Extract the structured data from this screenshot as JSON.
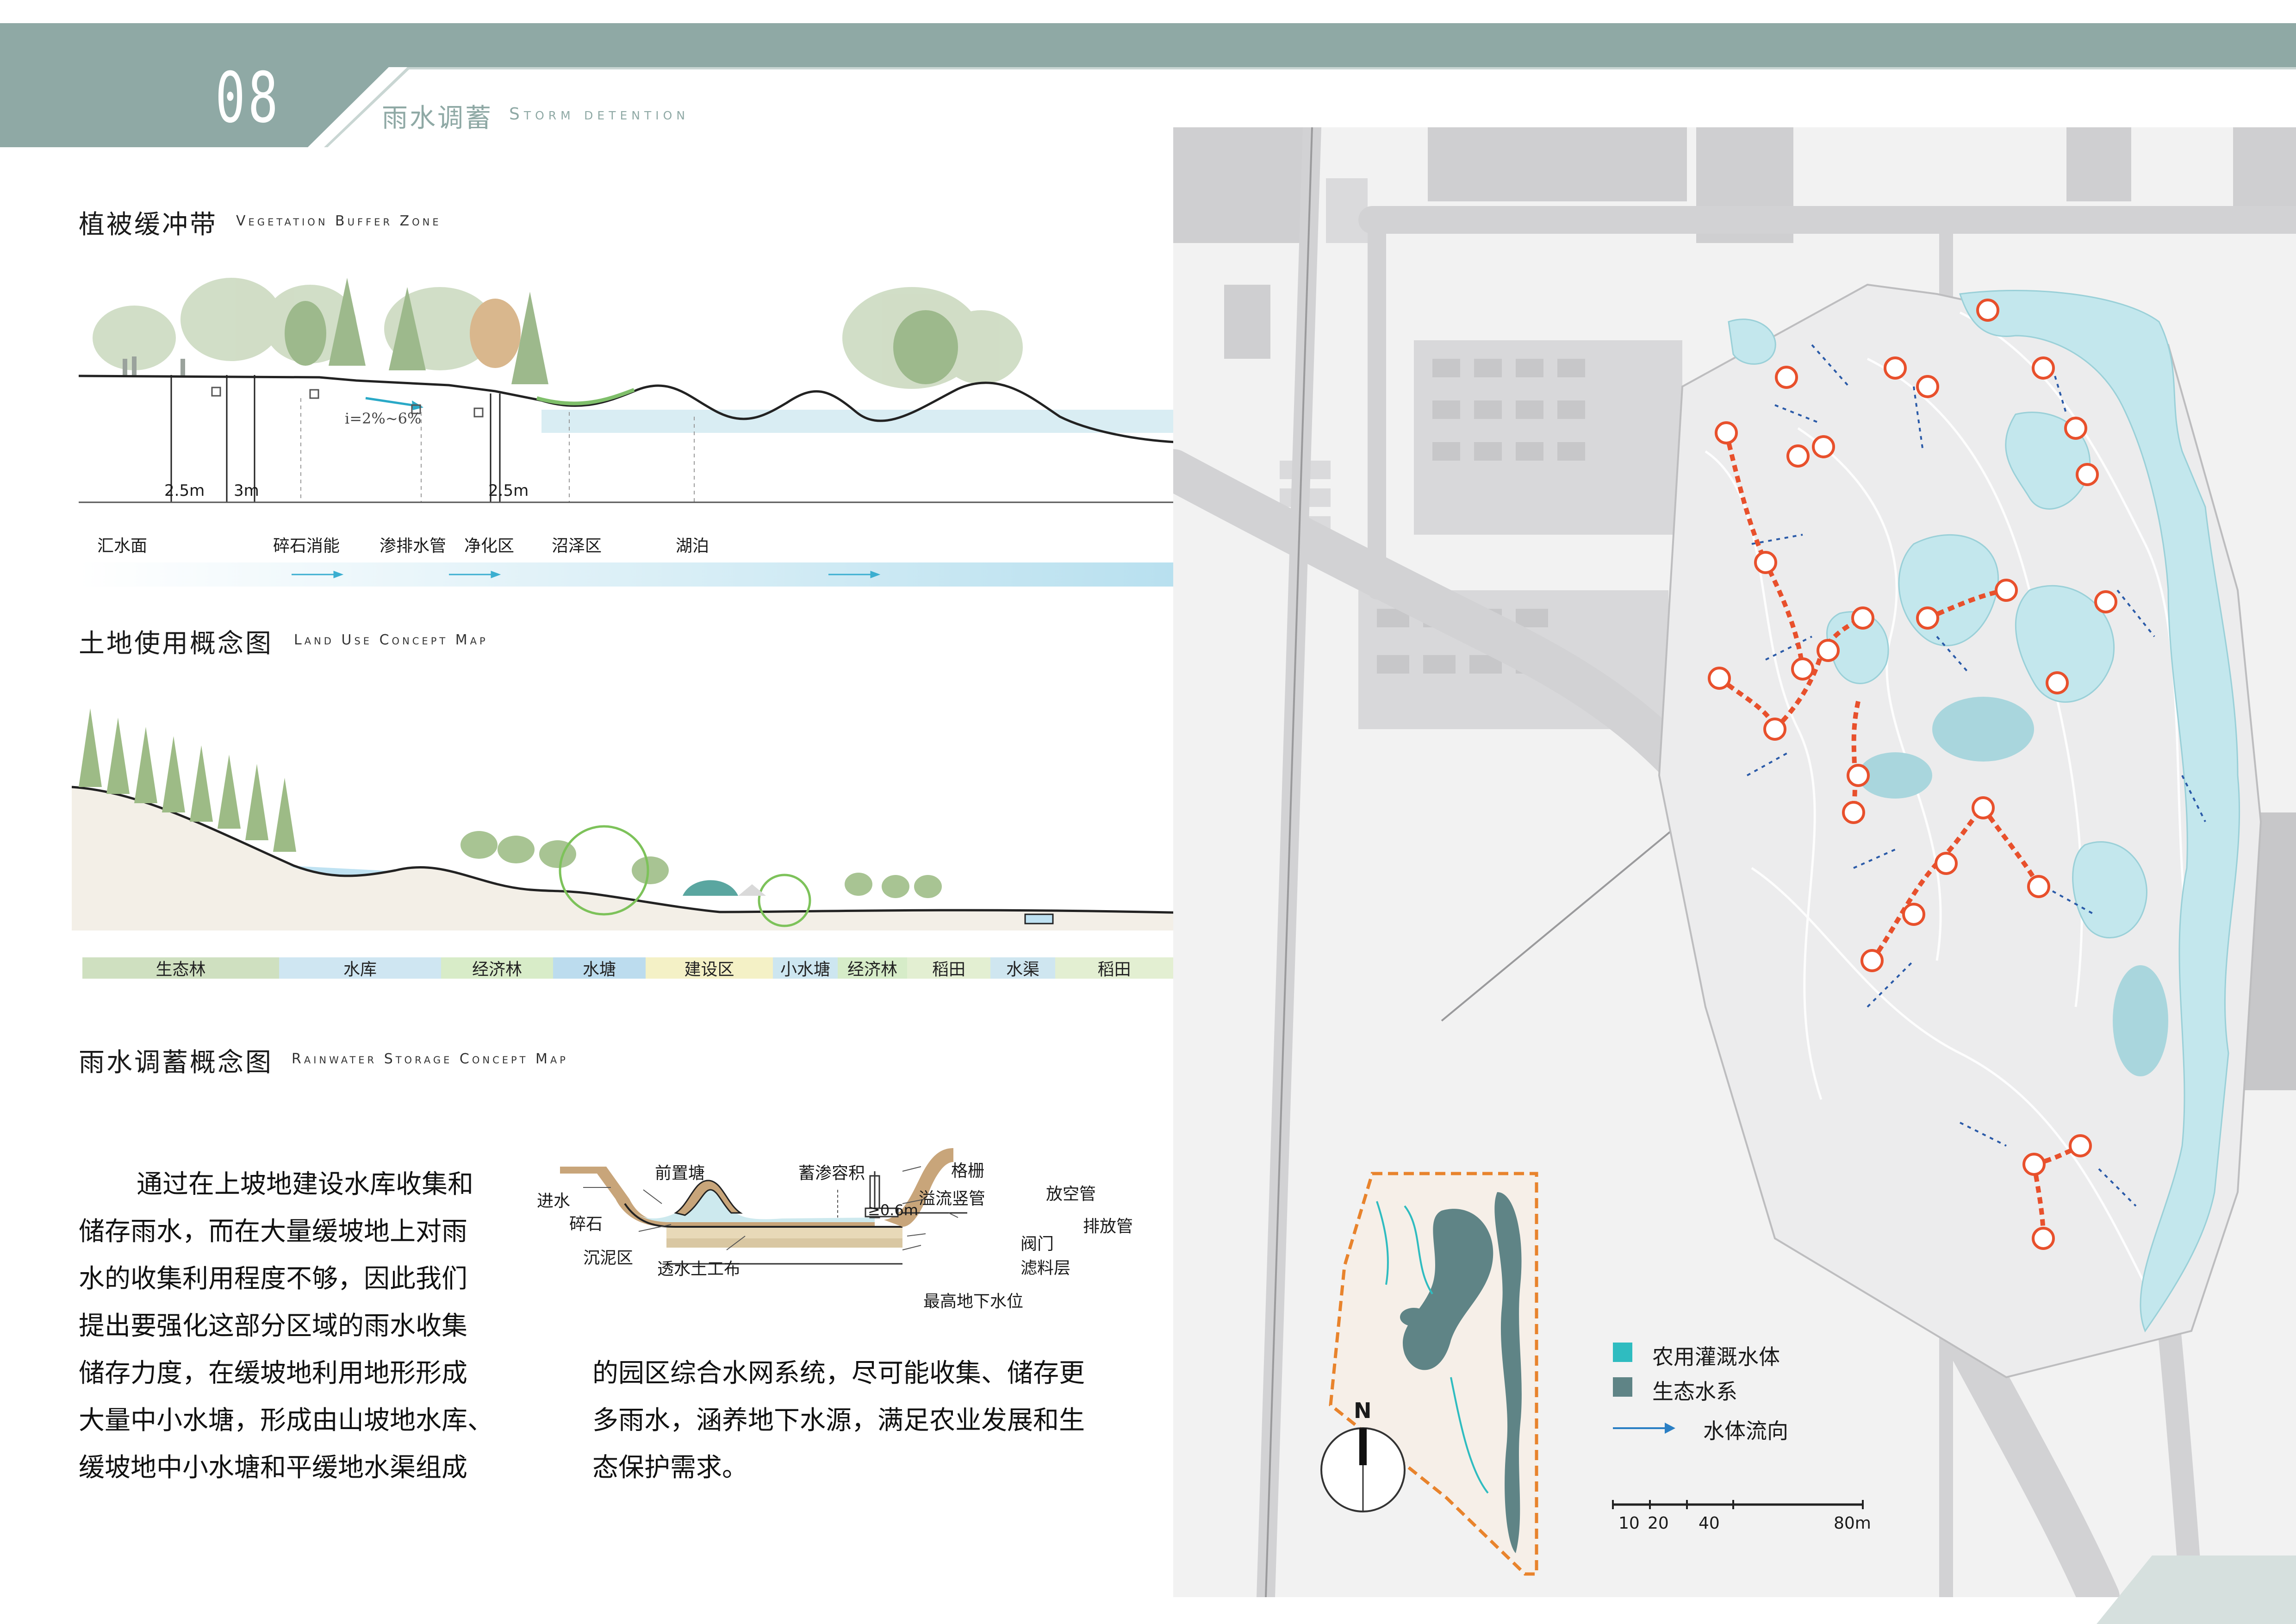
{
  "header": {
    "page_number": "08",
    "title_zh": "雨水调蓄",
    "title_en": "Storm detention"
  },
  "vegetation_section": {
    "title_zh": "植被缓冲带",
    "title_en": "Vegetation Buffer Zone",
    "slope": "i=2%~6%",
    "dims": [
      "2.5m",
      "3m",
      "2.5m"
    ],
    "labels": [
      "汇水面",
      "碎石消能",
      "渗排水管",
      "净化区",
      "沼泽区",
      "湖泊"
    ]
  },
  "landuse_section": {
    "title_zh": "土地使用概念图",
    "title_en": "Land Use Concept Map",
    "bands": [
      "生态林",
      "水库",
      "经济林",
      "水塘",
      "建设区",
      "小水塘",
      "经济林",
      "稻田",
      "水渠",
      "稻田"
    ],
    "band_colors": [
      "#cfe0c0",
      "#cfe6f2",
      "#d8ecc8",
      "#bcdcee",
      "#f4f1c6",
      "#cde6f0",
      "#d6ecc8",
      "#e3efd2",
      "#cfe6f0",
      "#e3efd2"
    ]
  },
  "rainwater_section": {
    "title_zh": "雨水调蓄概念图",
    "title_en": "Rainwater Storage Concept Map",
    "paragraph_left": [
      "通过在上坡地建设水库收集和",
      "储存雨水，而在大量缓坡地上对雨",
      "水的收集利用程度不够，因此我们",
      "提出要强化这部分区域的雨水收集",
      "储存力度，在缓坡地利用地形形成",
      "大量中小水塘，形成由山坡地水库、",
      "缓坡地中小水塘和平缓地水渠组成"
    ],
    "paragraph_right": [
      "的园区综合水网系统，尽可能收集、储存更",
      "多雨水，涵养地下水源，满足农业发展和生",
      "态保护需求。"
    ],
    "pond_labels": {
      "forebay": "前置塘",
      "storage": "蓄渗容积",
      "grille": "格栅",
      "inlet": "进水",
      "gravel": "碎石",
      "depth": "≥0.6m",
      "overflow": "溢流竖管",
      "drain_pipe": "放空管",
      "outlet": "排放管",
      "sediment": "沉泥区",
      "geotextile": "透水土工布",
      "valve": "阀门",
      "filter": "滤料层",
      "groundwater": "最高地下水位"
    }
  },
  "map": {
    "legend": [
      "农用灌溉水体",
      "生态水系",
      "水体流向"
    ],
    "legend_colors": [
      "#2fbcc0",
      "#5f8486",
      "#2a7fc4"
    ],
    "compass": "N",
    "scale": [
      "10",
      "20",
      "40",
      "80m"
    ]
  },
  "colors": {
    "header_band": "#8fa9a5",
    "header_text": "#8fa9a5",
    "water_light": "#bfe6ec",
    "flow_red": "#e8502c"
  }
}
